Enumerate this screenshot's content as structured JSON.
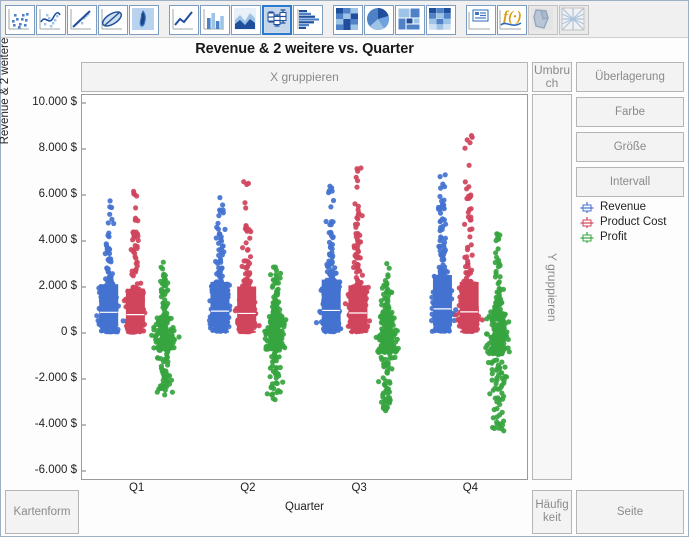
{
  "toolbar": {
    "groups": [
      {
        "name": "group-scatter",
        "buttons": [
          {
            "icon": "scatter-plot-icon",
            "state": "normal"
          },
          {
            "icon": "scatter-smooth-icon",
            "state": "normal"
          },
          {
            "icon": "scatter-regression-icon",
            "state": "normal"
          },
          {
            "icon": "scatter-ellipse-icon",
            "state": "normal"
          },
          {
            "icon": "density-contour-icon",
            "state": "normal"
          }
        ]
      },
      {
        "name": "group-series",
        "buttons": [
          {
            "icon": "line-chart-icon",
            "state": "normal"
          },
          {
            "icon": "bar-chart-icon",
            "state": "normal"
          },
          {
            "icon": "area-chart-icon",
            "state": "normal"
          },
          {
            "icon": "box-plot-icon",
            "state": "selected"
          },
          {
            "icon": "histogram-horizontal-icon",
            "state": "normal"
          }
        ]
      },
      {
        "name": "group-matrix",
        "buttons": [
          {
            "icon": "heatmap-icon",
            "state": "normal"
          },
          {
            "icon": "pie-chart-icon",
            "state": "normal"
          },
          {
            "icon": "treemap-icon",
            "state": "normal"
          },
          {
            "icon": "mosaic-icon",
            "state": "normal"
          }
        ]
      },
      {
        "name": "group-tools",
        "buttons": [
          {
            "icon": "data-table-icon",
            "state": "normal"
          },
          {
            "icon": "function-curve-icon",
            "state": "normal"
          },
          {
            "icon": "map-region-icon",
            "state": "disabled"
          },
          {
            "icon": "map-grid-icon",
            "state": "disabled"
          }
        ]
      }
    ]
  },
  "chart_title": "Revenue & 2 weitere vs. Quarter",
  "zones": {
    "x_group": "X gruppieren",
    "umbruch": "Umbruch",
    "y_group": "Y gruppieren",
    "overlay": "Überlagerung",
    "color": "Farbe",
    "size": "Größe",
    "interval": "Intervall",
    "kartenform": "Kartenform",
    "haeufigkeit": "Häufigkeit",
    "seite": "Seite"
  },
  "legend": {
    "position": "right",
    "items": [
      {
        "label": "Revenue",
        "color": "#4472d0",
        "glyph": "box-plot-marker"
      },
      {
        "label": "Product Cost",
        "color": "#d0455c",
        "glyph": "box-plot-marker"
      },
      {
        "label": "Profit",
        "color": "#37a540",
        "glyph": "box-plot-marker"
      }
    ]
  },
  "chart_data": {
    "type": "scatter",
    "plot_style": "jittered dot plot with box-plot overlay",
    "title": "Revenue & 2 weitere vs. Quarter",
    "xlabel": "Quarter",
    "ylabel": "Revenue & 2 weitere",
    "grid": false,
    "categories": [
      "Q1",
      "Q2",
      "Q3",
      "Q4"
    ],
    "ylim": [
      -6000,
      10000
    ],
    "ytick_values": [
      10000,
      8000,
      6000,
      4000,
      2000,
      0,
      -2000,
      -4000,
      -6000
    ],
    "ytick_labels": [
      "10.000 $",
      "8.000 $",
      "6.000 $",
      "4.000 $",
      "2.000 $",
      "0 $",
      "-2.000 $",
      "-4.000 $",
      "-6.000 $"
    ],
    "xtick_labels": [
      "Q1",
      "Q2",
      "Q3",
      "Q4"
    ],
    "series": [
      {
        "name": "Revenue",
        "color": "#4472d0",
        "groups": [
          {
            "category": "Q1",
            "n": 260,
            "min": 50,
            "q1": 300,
            "median": 900,
            "q3": 2100,
            "max": 5800,
            "box_drawn": true
          },
          {
            "category": "Q2",
            "n": 250,
            "min": 60,
            "q1": 320,
            "median": 950,
            "q3": 2200,
            "max": 6200,
            "box_drawn": true
          },
          {
            "category": "Q3",
            "n": 270,
            "min": 60,
            "q1": 330,
            "median": 980,
            "q3": 2300,
            "max": 6500,
            "box_drawn": true
          },
          {
            "category": "Q4",
            "n": 300,
            "min": 70,
            "q1": 360,
            "median": 1050,
            "q3": 2500,
            "max": 7500,
            "box_drawn": true
          }
        ]
      },
      {
        "name": "Product Cost",
        "color": "#d0455c",
        "groups": [
          {
            "category": "Q1",
            "n": 260,
            "min": 40,
            "q1": 260,
            "median": 800,
            "q3": 1900,
            "max": 6400,
            "box_drawn": true
          },
          {
            "category": "Q2",
            "n": 250,
            "min": 50,
            "q1": 280,
            "median": 850,
            "q3": 2000,
            "max": 6600,
            "box_drawn": true
          },
          {
            "category": "Q3",
            "n": 270,
            "min": 50,
            "q1": 290,
            "median": 870,
            "q3": 2050,
            "max": 7200,
            "box_drawn": true
          },
          {
            "category": "Q4",
            "n": 300,
            "min": 60,
            "q1": 310,
            "median": 920,
            "q3": 2200,
            "max": 9200,
            "box_drawn": true
          }
        ]
      },
      {
        "name": "Profit",
        "color": "#37a540",
        "groups": [
          {
            "category": "Q1",
            "n": 260,
            "min": -2700,
            "q1": -650,
            "median": 60,
            "q3": 700,
            "max": 3100,
            "box_drawn": false
          },
          {
            "category": "Q2",
            "n": 250,
            "min": -2900,
            "q1": -700,
            "median": 70,
            "q3": 750,
            "max": 3000,
            "box_drawn": false
          },
          {
            "category": "Q3",
            "n": 270,
            "min": -3400,
            "q1": -800,
            "median": 80,
            "q3": 800,
            "max": 3100,
            "box_drawn": false
          },
          {
            "category": "Q4",
            "n": 300,
            "min": -4300,
            "q1": -900,
            "median": 100,
            "q3": 950,
            "max": 4400,
            "box_drawn": false
          }
        ]
      }
    ]
  }
}
